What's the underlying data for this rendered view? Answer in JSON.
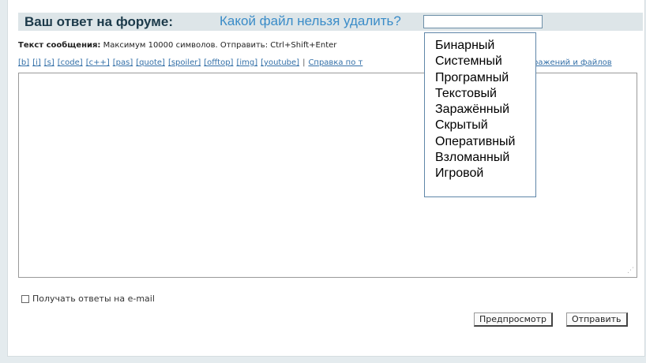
{
  "form": {
    "title": "Ваш ответ  на форуме:",
    "question": "Какой файл нельзя удалить?",
    "answer_value": ""
  },
  "message": {
    "label": "Текст сообщения:",
    "hint": " Максимум 10000 символов. Отправить: Ctrl+Shift+Enter"
  },
  "toolbar": {
    "tags": [
      "[b]",
      "[i]",
      "[s]",
      "[code]",
      "[c++]",
      "[pas]",
      "[quote]",
      "[spoiler]",
      "[offtop]",
      "[img]",
      "[youtube]"
    ],
    "separator": "|",
    "help_link_visible": "Справка по т",
    "upload_link_visible": "ражений и файлов"
  },
  "editor": {
    "value": "",
    "resize_grip": "⋰"
  },
  "email_option": {
    "label": "Получать ответы на e-mail",
    "checked": false
  },
  "buttons": {
    "preview": "Предпросмотр",
    "send": "Отправить"
  },
  "dropdown": {
    "options": [
      "Бинарный",
      "Системный",
      "Програмный",
      "Текстовый",
      "Заражённый",
      "Скрытый",
      "Оперативный",
      "Взломанный",
      "Игровой"
    ]
  }
}
